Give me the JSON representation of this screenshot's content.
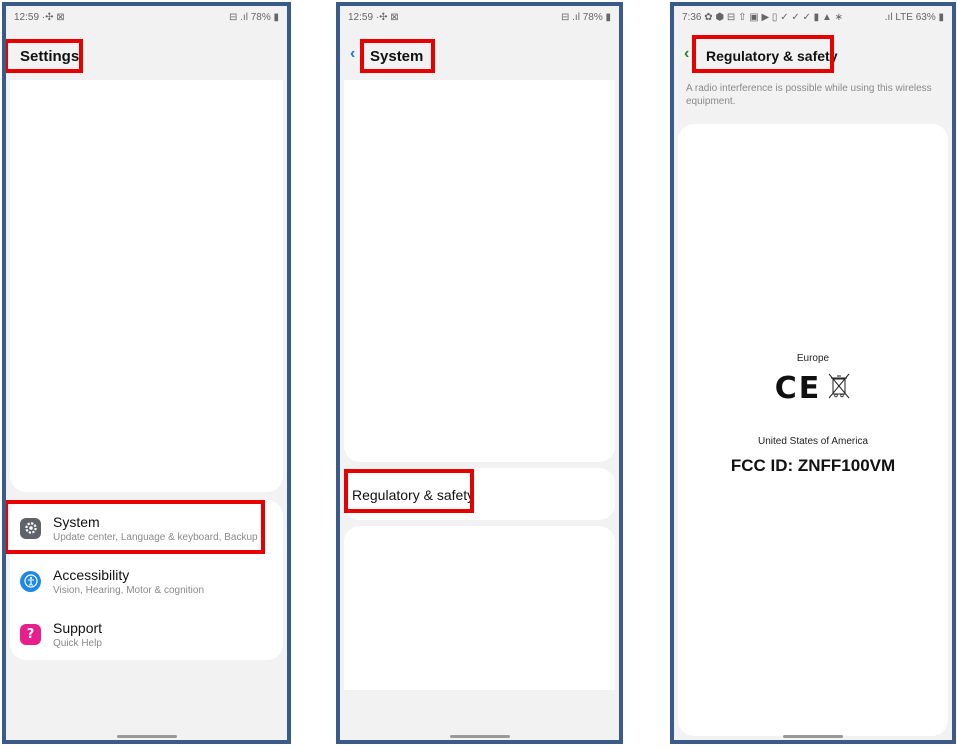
{
  "colors": {
    "frame_border": "#3a5a8a",
    "highlight": "#e60000",
    "screen_bg": "#f2f2f2",
    "card_bg": "#ffffff",
    "accent_back": "#1a73e8",
    "accessibility_icon": "#1e88e5",
    "support_icon": "#e91e8c",
    "system_icon": "#5f6368"
  },
  "screen1": {
    "status": {
      "time": "12:59 ·✣ ⊠",
      "indicators": "⊟ .ıl 78% ▮"
    },
    "title": "Settings",
    "items": [
      {
        "title": "System",
        "subtitle": "Update center, Language & keyboard, Backup",
        "icon": "gear-icon"
      },
      {
        "title": "Accessibility",
        "subtitle": "Vision, Hearing, Motor & cognition",
        "icon": "accessibility-icon"
      },
      {
        "title": "Support",
        "subtitle": "Quick Help",
        "icon": "question-icon"
      }
    ]
  },
  "screen2": {
    "status": {
      "time": "12:59 ·✣ ⊠",
      "indicators": "⊟ .ıl 78% ▮"
    },
    "title": "System",
    "back_icon": "‹",
    "item": "Regulatory & safety"
  },
  "screen3": {
    "status": {
      "time": "7:36 ✿ ⬢ ⊟ ⇧ ▣ ▶ ▯ ✓ ✓ ✓ ▮ ▲ ∗",
      "indicators": ".ıl LTE 63% ▮"
    },
    "title": "Regulatory & safety",
    "back_icon": "‹",
    "description": "A radio interference is possible while using this wireless equipment.",
    "region_europe": "Europe",
    "ce_mark": "CE",
    "region_usa": "United States of America",
    "fcc_id": "FCC ID: ZNFF100VM"
  }
}
